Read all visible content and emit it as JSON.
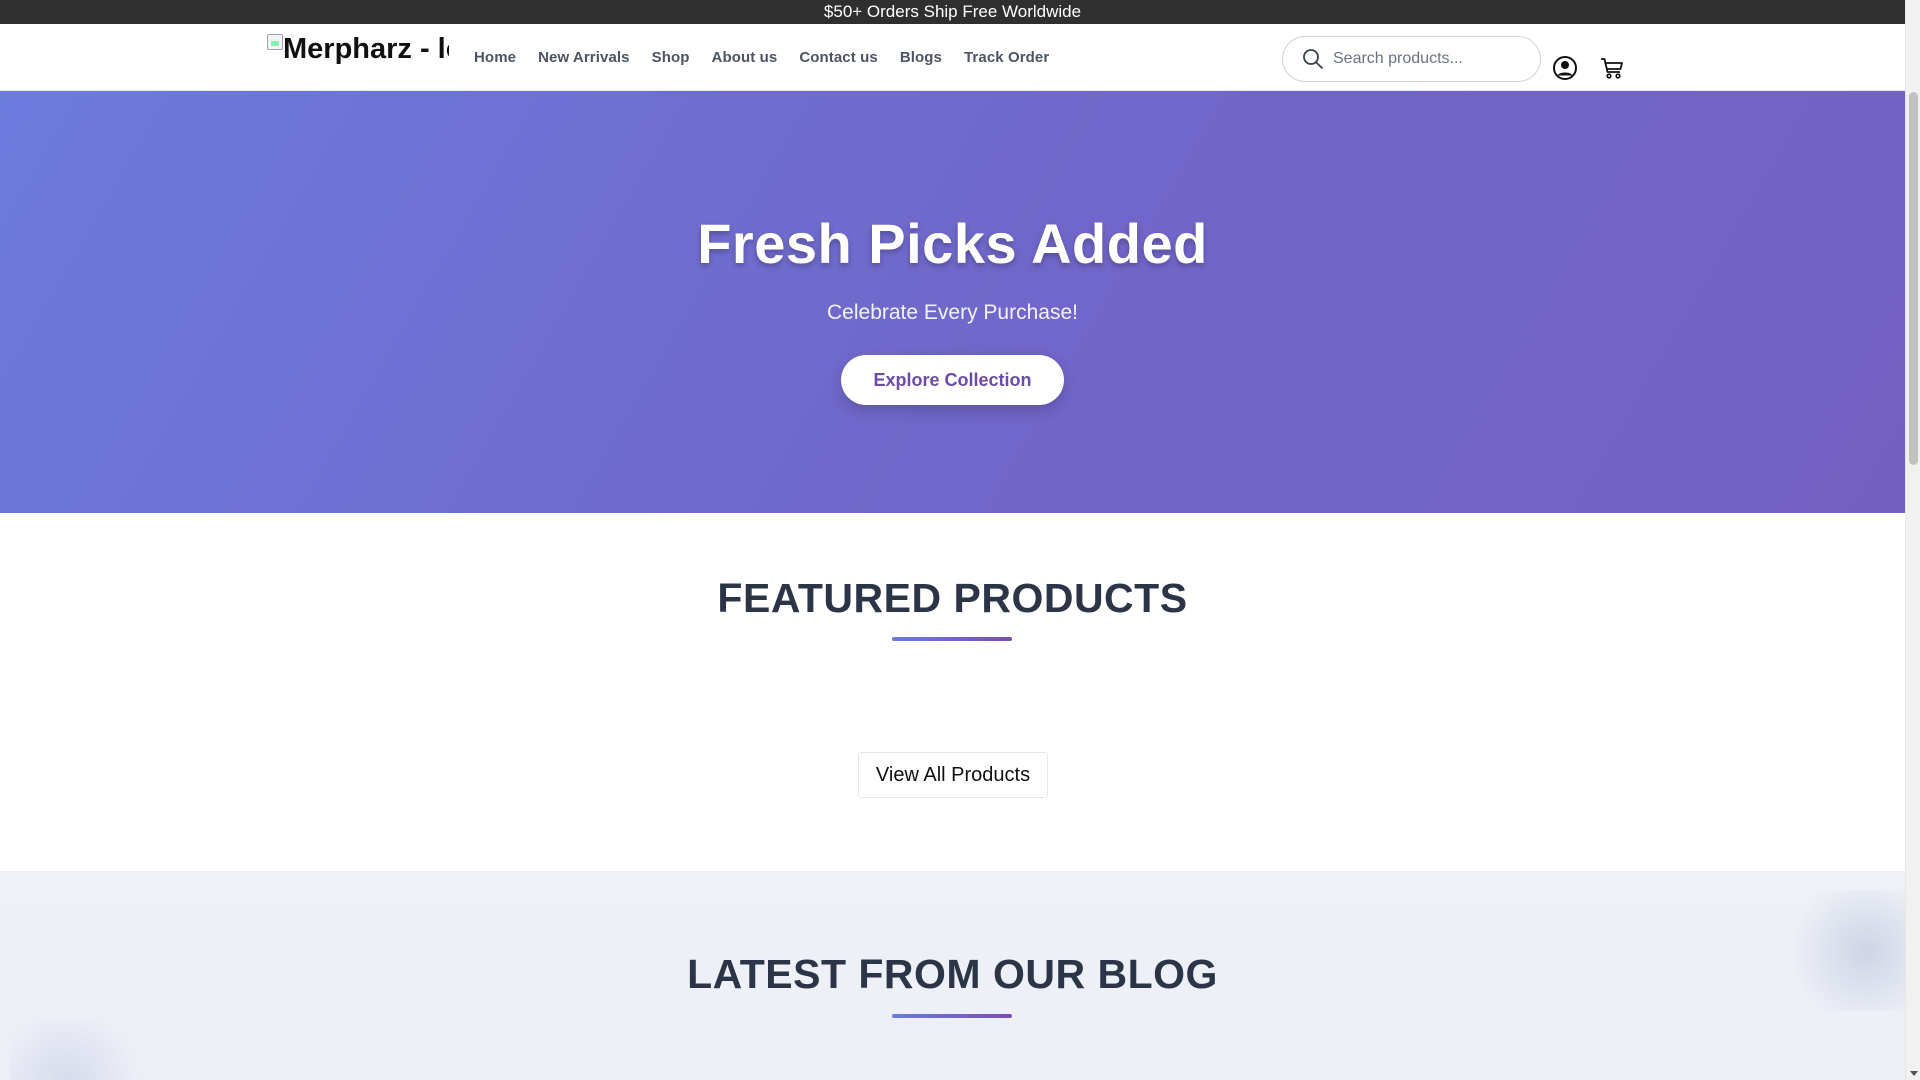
{
  "announcement": "$50+ Orders Ship Free Worldwide",
  "header": {
    "logo_alt": "Merpharz - lo",
    "nav": [
      "Home",
      "New Arrivals",
      "Shop",
      "About us",
      "Contact us",
      "Blogs",
      "Track Order"
    ],
    "search_placeholder": "Search products...",
    "icons": [
      "search-icon",
      "account-icon",
      "cart-icon"
    ]
  },
  "hero": {
    "title": "Fresh Picks Added",
    "subtitle": "Celebrate Every Purchase!",
    "cta_label": "Explore Collection"
  },
  "featured": {
    "title": "FEATURED PRODUCTS",
    "view_all_label": "View All Products"
  },
  "blog": {
    "title": "LATEST FROM OUR BLOG"
  },
  "colors": {
    "announcement_bg": "#2f2f2f",
    "hero_gradient_start": "#6b7bdc",
    "hero_gradient_end": "#7361c2",
    "cta_text": "#6d4ba8",
    "heading": "#2c3447"
  }
}
